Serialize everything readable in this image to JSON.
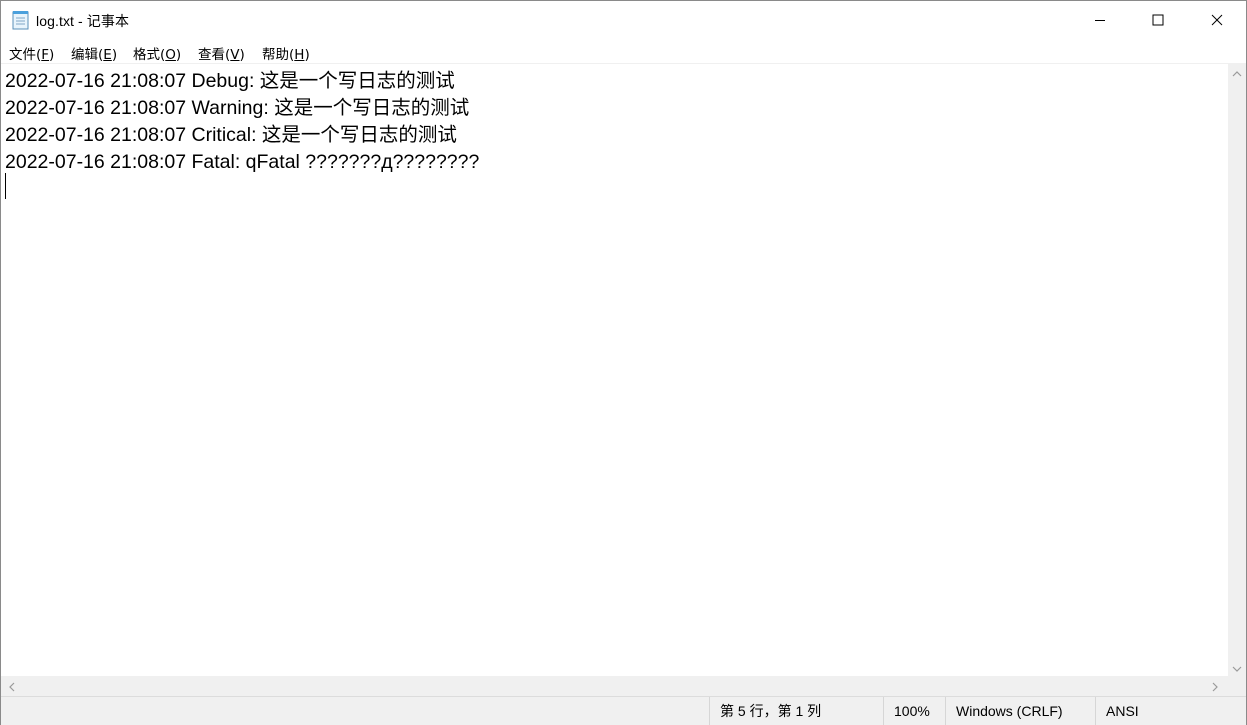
{
  "window": {
    "title": "log.txt - 记事本"
  },
  "menu": {
    "items": [
      {
        "label": "文件(",
        "key": "F",
        "suffix": ")"
      },
      {
        "label": "编辑(",
        "key": "E",
        "suffix": ")"
      },
      {
        "label": "格式(",
        "key": "O",
        "suffix": ")"
      },
      {
        "label": "查看(",
        "key": "V",
        "suffix": ")"
      },
      {
        "label": "帮助(",
        "key": "H",
        "suffix": ")"
      }
    ]
  },
  "editor": {
    "lines": [
      "2022-07-16 21:08:07 Debug: 这是一个写日志的测试",
      "2022-07-16 21:08:07 Warning: 这是一个写日志的测试",
      "2022-07-16 21:08:07 Critical: 这是一个写日志的测试",
      "2022-07-16 21:08:07 Fatal: qFatal ???????д????????"
    ]
  },
  "status": {
    "position": "第 5 行，第 1 列",
    "zoom": "100%",
    "line_ending": "Windows (CRLF)",
    "encoding": "ANSI"
  },
  "icons": {
    "app": "notepad-icon",
    "minimize": "minimize-icon",
    "maximize": "maximize-icon",
    "close": "close-icon"
  }
}
